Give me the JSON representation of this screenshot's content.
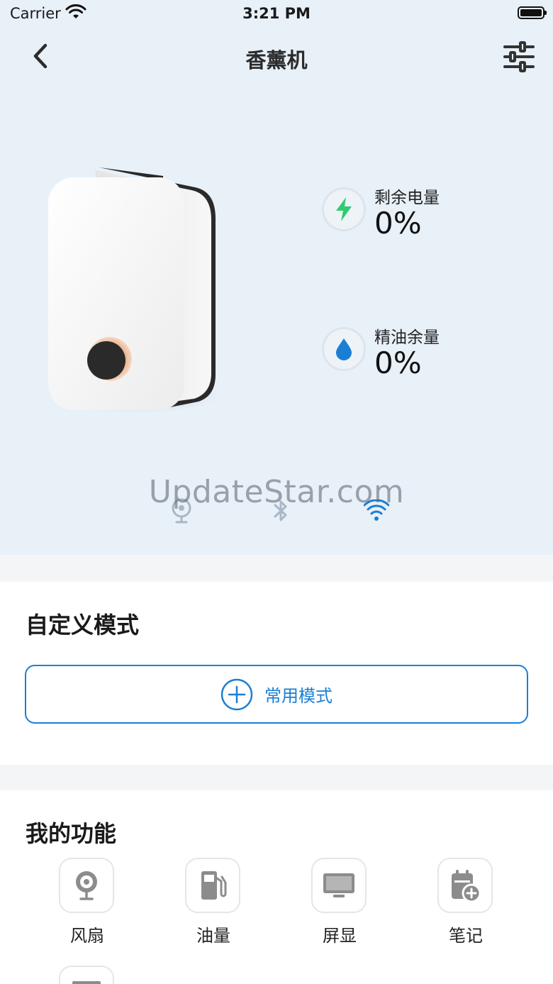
{
  "status_bar": {
    "carrier": "Carrier",
    "time": "3:21 PM"
  },
  "nav": {
    "title": "香薰机",
    "back_icon": "chevron-left-icon",
    "settings_icon": "sliders-icon"
  },
  "stats": [
    {
      "label": "剩余电量",
      "value": "0%",
      "icon": "lightning-icon",
      "icon_color": "#2ecc71"
    },
    {
      "label": "精油余量",
      "value": "0%",
      "icon": "water-drop-icon",
      "icon_color": "#1a7fd4"
    }
  ],
  "connections": [
    {
      "name": "fan-status-icon",
      "active": false
    },
    {
      "name": "bluetooth-icon",
      "active": false
    },
    {
      "name": "wifi-icon",
      "active": true,
      "color": "#1a7fd4"
    }
  ],
  "watermark": "UpdateStar.com",
  "custom_mode": {
    "title": "自定义模式",
    "button_label": "常用模式",
    "button_icon": "plus-circle-icon"
  },
  "functions": {
    "title": "我的功能",
    "items": [
      {
        "label": "风扇",
        "icon": "fan-icon"
      },
      {
        "label": "油量",
        "icon": "fuel-pump-icon"
      },
      {
        "label": "屏显",
        "icon": "monitor-icon"
      },
      {
        "label": "笔记",
        "icon": "calendar-add-icon"
      }
    ]
  },
  "colors": {
    "accent": "#1a7fd4",
    "hero_bg": "#e8f0f8",
    "icon_gray": "#8c8c8c"
  }
}
